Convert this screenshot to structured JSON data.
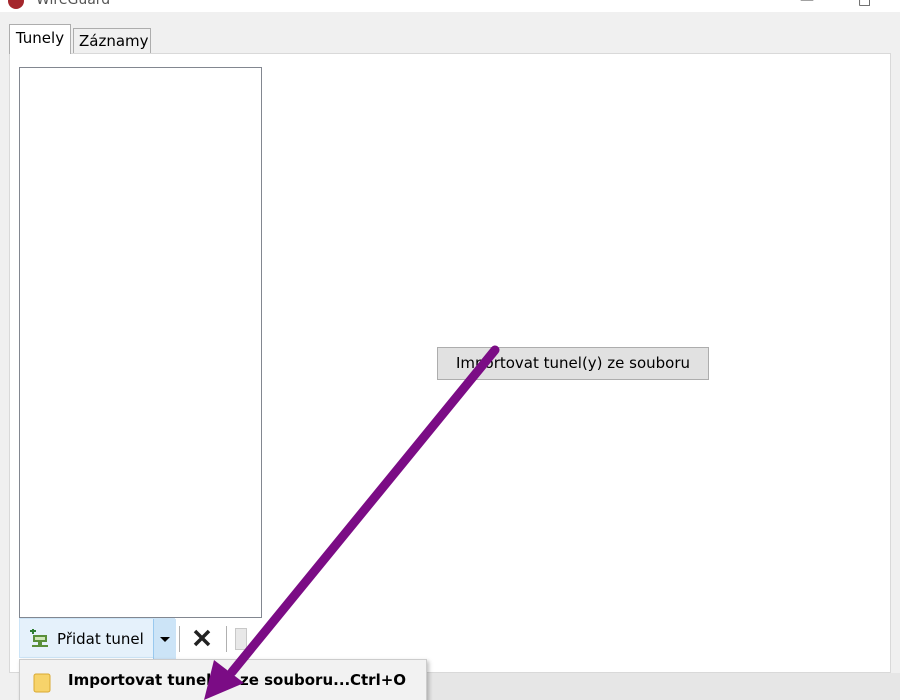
{
  "window": {
    "title": "WireGuard",
    "minimize_glyph": "—",
    "maximize_glyph": "□"
  },
  "tabs": [
    {
      "label": "Tunely",
      "active": true
    },
    {
      "label": "Záznamy",
      "active": false
    }
  ],
  "main": {
    "import_button_label": "Importovat tunel(y) ze souboru"
  },
  "toolbar": {
    "add_tunnel_label": "Přidat tunel",
    "add_icon": "add-tunnel-icon",
    "delete_icon": "delete-icon",
    "export_icon": "export-icon"
  },
  "menu": {
    "items": [
      {
        "label": "Importovat tunel(y) ze souboru...",
        "shortcut": "Ctrl+O",
        "icon": "folder-icon"
      }
    ]
  },
  "colors": {
    "annotation_arrow": "#7b0c85",
    "app_icon": "#a4262c",
    "add_button_bg": "#e5f1fb"
  }
}
